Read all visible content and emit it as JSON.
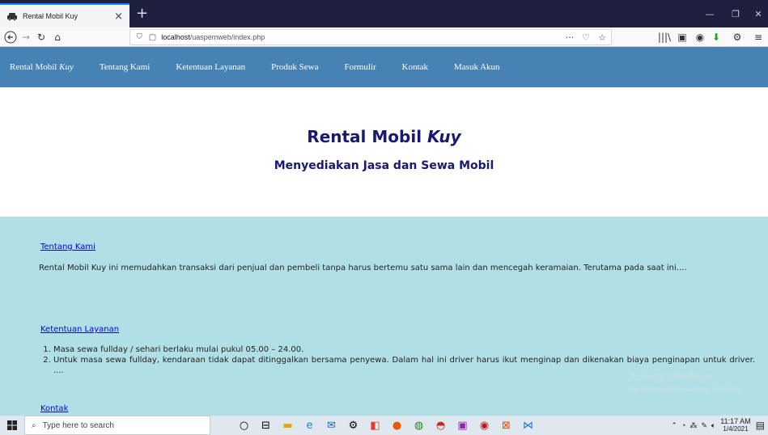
{
  "browser": {
    "tab_title": "Rental Mobil Kuy",
    "url_prefix": "localhost",
    "url_path": "/uaspemweb/index.php"
  },
  "nav": {
    "brand": "Rental Mobil ",
    "brand_italic": "Kuy",
    "items": [
      "Tentang Kami",
      "Ketentuan Layanan",
      "Produk Sewa",
      "Formulir",
      "Kontak",
      "Masuk Akun"
    ]
  },
  "hero": {
    "title": "Rental Mobil ",
    "title_italic": "Kuy",
    "subtitle": "Menyediakan Jasa dan Sewa Mobil"
  },
  "sections": {
    "about_link": "Tentang Kami",
    "about_text": "Rental Mobil Kuy ini memudahkan transaksi dari penjual dan pembeli tanpa harus bertemu satu sama lain dan mencegah keramaian. Terutama pada saat ini....",
    "terms_link": "Ketentuan Layanan",
    "terms": [
      "Masa sewa fullday / sehari berlaku mulai pukul 05.00 – 24.00.",
      "Untuk masa sewa fullday, kendaraan tidak dapat ditinggalkan bersama penyewa. Dalam hal ini driver harus ikut menginap dan dikenakan biaya penginapan untuk driver. ...."
    ],
    "contact_link": "Kontak"
  },
  "watermark": {
    "line1": "Activate Windows",
    "line2": "Go to Settings to activate Windows."
  },
  "taskbar": {
    "search_placeholder": "Type here to search",
    "time": "11:17 AM",
    "date": "1/4/2021"
  }
}
